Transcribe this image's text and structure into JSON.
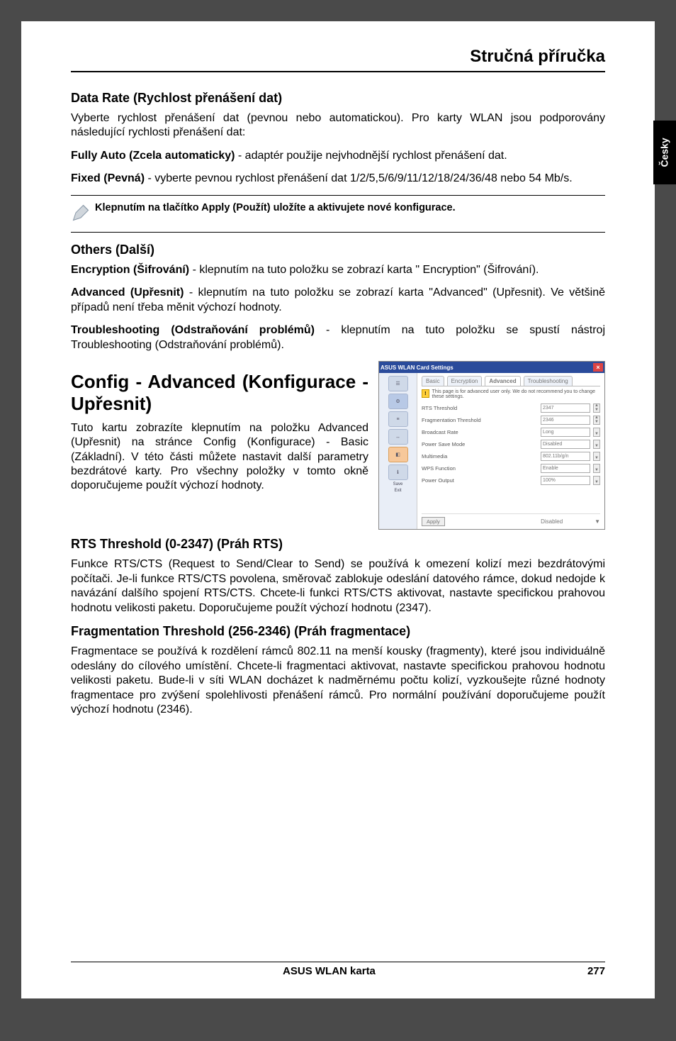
{
  "page": {
    "header": "Stručná příručka",
    "side_tab": "Česky",
    "footer_center": "ASUS WLAN karta",
    "footer_right": "277"
  },
  "s1": {
    "heading": "Data Rate (Rychlost přenášení dat)",
    "p1": "Vyberte rychlost přenášení dat (pevnou nebo automatickou). Pro karty WLAN jsou podporovány následující rychlosti přenášení dat:",
    "p2b": "Fully Auto (Zcela automaticky)",
    "p2": " - adaptér použije nejvhodnější rychlost přenášení dat.",
    "p3b": "Fixed (Pevná)",
    "p3": " - vyberte pevnou rychlost přenášení dat 1/2/5,5/6/9/11/12/18/24/36/48 nebo 54 Mb/s."
  },
  "note": {
    "text": "Klepnutím na tlačítko Apply (Použít) uložíte a aktivujete nové konfigurace."
  },
  "s2": {
    "heading": "Others (Další)",
    "p1b": "Encryption (Šifrování)",
    "p1": " - klepnutím na tuto položku se zobrazí karta \" Encryption\" (Šifrování).",
    "p2b": "Advanced (Upřesnit)",
    "p2": " - klepnutím na tuto položku se zobrazí karta \"Advanced\" (Upřesnit). Ve většině případů není třeba měnit výchozí hodnoty.",
    "p3b": "Troubleshooting (Odstraňování problémů)",
    "p3": " - klepnutím na tuto položku se spustí nástroj Troubleshooting (Odstraňování problémů)."
  },
  "s3": {
    "heading": "Config - Advanced (Konfigurace - Upřesnit)",
    "para": "Tuto kartu zobrazíte klepnutím na položku Advanced (Upřesnit) na stránce Config (Konfigurace) - Basic (Základní). V této části můžete nastavit další parametry bezdrátové karty. Pro všechny položky v tomto okně doporučujeme použít výchozí hodnoty."
  },
  "screenshot": {
    "title": "ASUS WLAN Card Settings",
    "tabs": {
      "t1": "Basic",
      "t2": "Encryption",
      "t3": "Advanced",
      "t4": "Troubleshooting"
    },
    "warn": "This page is for advanced user only. We do not recommend you to change these settings.",
    "rows": {
      "r1l": "RTS Threshold",
      "r1v": "2347",
      "r2l": "Fragmentation Threshold",
      "r2v": "2346",
      "r3l": "Broadcast Rate",
      "r3v": "Long",
      "r4l": "Power Save Mode",
      "r4v": "Disabled",
      "r5l": "Multimedia",
      "r5v": "802.11b/g/n",
      "r6l": "WPS Function",
      "r6v": "Enable",
      "r7l": "Power Output",
      "r7v": "100%"
    },
    "apply": "Apply",
    "status": "Disabled"
  },
  "s4": {
    "heading": "RTS Threshold (0-2347) (Práh RTS)",
    "para": "Funkce RTS/CTS (Request to Send/Clear to Send) se používá k omezení kolizí mezi bezdrátovými počítači. Je-li funkce RTS/CTS povolena, směrovač zablokuje odeslání datového rámce, dokud nedojde k navázání dalšího spojení RTS/CTS. Chcete-li funkci RTS/CTS aktivovat, nastavte specifickou prahovou hodnotu velikosti paketu. Doporučujeme použít výchozí hodnotu (2347)."
  },
  "s5": {
    "heading": "Fragmentation Threshold (256-2346) (Práh fragmentace)",
    "para": "Fragmentace se používá k rozdělení rámců 802.11 na menší kousky (fragmenty), které jsou individuálně odeslány do cílového umístění. Chcete-li fragmentaci aktivovat, nastavte specifickou prahovou hodnotu velikosti paketu. Bude-li v síti WLAN docházet k nadměrnému počtu kolizí, vyzkoušejte různé hodnoty fragmentace pro zvýšení spolehlivosti přenášení rámců. Pro normální používání doporučujeme použít výchozí hodnotu (2346)."
  }
}
